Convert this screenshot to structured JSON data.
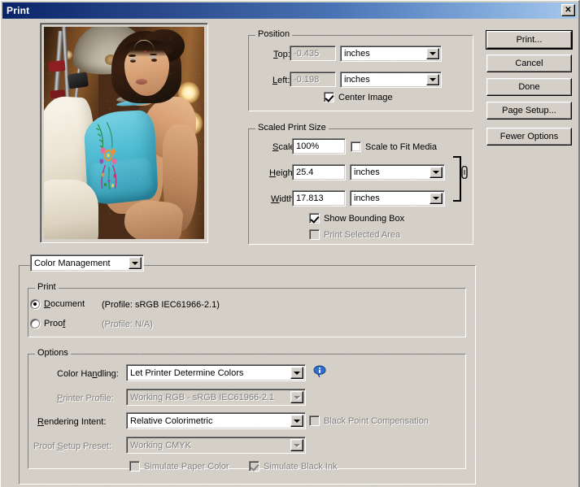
{
  "window": {
    "title": "Print",
    "close_label": "✕"
  },
  "preview": {
    "alt": "print-preview-photo-woman-teal-top"
  },
  "position": {
    "legend": "Position",
    "top_label": "Top:",
    "top_value": "-0.435",
    "top_units": "inches",
    "left_label": "Left:",
    "left_value": "-0.198",
    "left_units": "inches",
    "center_image_label": "Center Image",
    "center_image_checked": true
  },
  "scaled_print_size": {
    "legend": "Scaled Print Size",
    "scale_label": "Scale:",
    "scale_value": "100%",
    "scale_to_fit_label": "Scale to Fit Media",
    "scale_to_fit_checked": false,
    "height_label": "Height:",
    "height_value": "25.4",
    "height_units": "inches",
    "width_label": "Width:",
    "width_value": "17.813",
    "width_units": "inches",
    "show_bounding_box_label": "Show Bounding Box",
    "show_bounding_box_checked": true,
    "print_selected_area_label": "Print Selected Area",
    "print_selected_area_checked": false
  },
  "buttons": {
    "print": "Print...",
    "cancel": "Cancel",
    "done": "Done",
    "page_setup": "Page Setup...",
    "fewer_options": "Fewer Options"
  },
  "section_selector": {
    "value": "Color Management"
  },
  "print_group": {
    "legend": "Print",
    "document_label": "Document",
    "document_profile": "(Profile: sRGB IEC61966-2.1)",
    "document_selected": true,
    "proof_label": "Proof",
    "proof_profile": "(Profile: N/A)",
    "proof_selected": false
  },
  "options": {
    "legend": "Options",
    "color_handling_label": "Color Handling:",
    "color_handling_value": "Let Printer Determine Colors",
    "info_icon": "info-balloon-icon",
    "printer_profile_label": "Printer Profile:",
    "printer_profile_value": "Working RGB - sRGB IEC61966-2.1",
    "rendering_intent_label": "Rendering Intent:",
    "rendering_intent_value": "Relative Colorimetric",
    "black_point_label": "Black Point Compensation",
    "black_point_checked": false,
    "proof_setup_label": "Proof Setup Preset:",
    "proof_setup_value": "Working CMYK",
    "simulate_paper_label": "Simulate Paper Color",
    "simulate_paper_checked": false,
    "simulate_black_label": "Simulate Black Ink",
    "simulate_black_checked": true
  },
  "colors": {
    "dialog_face": "#d4d0c8",
    "title_gradient_start": "#0a246a",
    "title_gradient_end": "#a6c8ec",
    "disabled_text": "#808080",
    "accent_teal": "#55c0d6"
  }
}
